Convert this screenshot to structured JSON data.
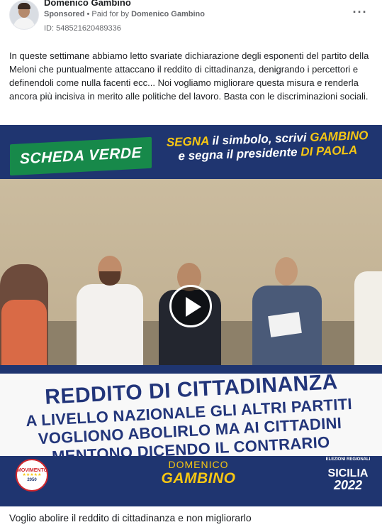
{
  "header": {
    "page_name": "Domenico Gambino",
    "sponsored_label": "Sponsored",
    "paid_for_prefix": " • Paid for by ",
    "paid_for_name": "Domenico Gambino",
    "ad_id": "ID: 548521620489336",
    "more_icon": "more-options-icon"
  },
  "post": {
    "body": "In queste settimane abbiamo letto svariate dichiarazione degli esponenti del partito della Meloni che puntualmente attaccano il reddito di cittadinanza, denigrando i percettori e definendoli come nulla facenti ecc... Noi vogliamo migliorare questa misura e renderla ancora più incisiva in merito alle politiche del lavoro. Basta con le discriminazioni sociali."
  },
  "media": {
    "tag": "SCHEDA VERDE",
    "segna_1": "SEGNA",
    "segna_2": " il simbolo, scrivi ",
    "segna_3": "GAMBINO",
    "segna_4": "e segna il presidente ",
    "segna_5": "DI PAOLA",
    "headline_main": "REDDITO DI CITTADINANZA",
    "headline_line_2": "A LIVELLO NAZIONALE GLI ALTRI PARTITI",
    "headline_line_3": "VOGLIONO ABOLIRLO MA AI CITTADINI",
    "headline_line_4": "MENTONO DICENDO IL CONTRARIO",
    "logo_text": "MOVIMENTO",
    "logo_stars": "★★★★★",
    "logo_year": "2050",
    "candidate_first": "DOMENICO",
    "candidate_last": "GAMBINO",
    "election_label_1": "ELEZIONI REGIONALI",
    "election_region": "SICILIA",
    "election_year": "2022",
    "play_icon": "play-icon"
  },
  "caption": "Voglio abolire il reddito di cittadinanza e non migliorarlo",
  "colors": {
    "navy": "#1f3570",
    "green": "#17894a",
    "yellow": "#f6c613"
  }
}
